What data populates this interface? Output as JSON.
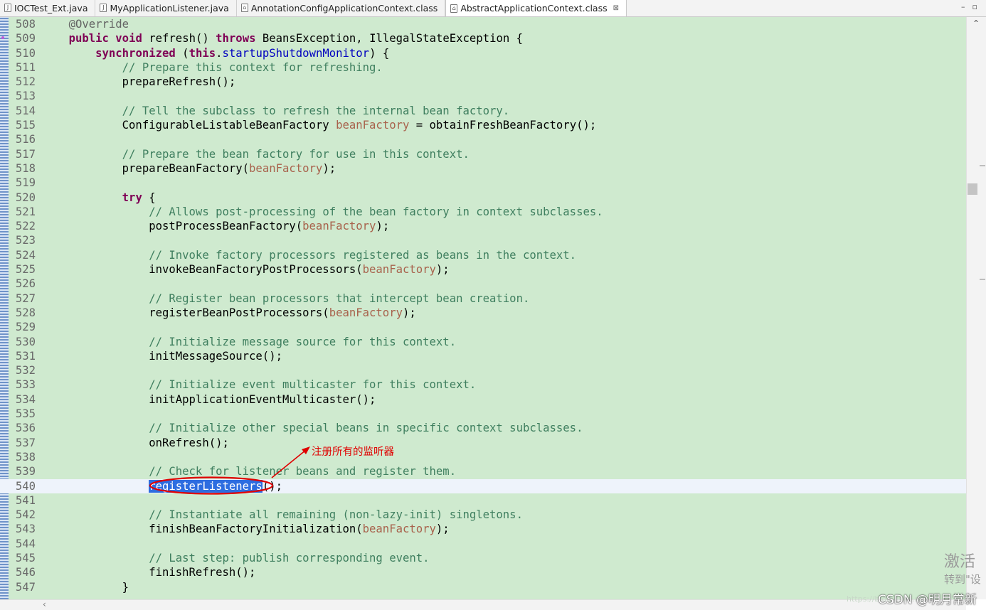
{
  "tabs": [
    {
      "label": "IOCTest_Ext.java",
      "icon": "java-file-icon",
      "active": false
    },
    {
      "label": "MyApplicationListener.java",
      "icon": "java-file-icon",
      "active": false
    },
    {
      "label": "AnnotationConfigApplicationContext.class",
      "icon": "class-file-icon",
      "active": false
    },
    {
      "label": "AbstractApplicationContext.class",
      "icon": "class-file-icon",
      "active": true,
      "close": "⊠"
    }
  ],
  "window_controls": {
    "minimize": "–",
    "maximize": "▫"
  },
  "editor": {
    "current_line": "540",
    "lines": [
      {
        "num": "508",
        "t": [
          {
            "c": "    "
          },
          {
            "c": "@Override",
            "k": "an"
          }
        ]
      },
      {
        "num": "509",
        "t": [
          {
            "c": "    "
          },
          {
            "c": "public",
            "k": "kw"
          },
          {
            "c": " "
          },
          {
            "c": "void",
            "k": "kw"
          },
          {
            "c": " refresh() "
          },
          {
            "c": "throws",
            "k": "kw"
          },
          {
            "c": " BeansException, IllegalStateException {"
          }
        ]
      },
      {
        "num": "510",
        "t": [
          {
            "c": "        "
          },
          {
            "c": "synchronized",
            "k": "kw"
          },
          {
            "c": " ("
          },
          {
            "c": "this",
            "k": "kw"
          },
          {
            "c": "."
          },
          {
            "c": "startupShutdownMonitor",
            "k": "fld"
          },
          {
            "c": ") {"
          }
        ]
      },
      {
        "num": "511",
        "t": [
          {
            "c": "            "
          },
          {
            "c": "// Prepare this context for refreshing.",
            "k": "cm"
          }
        ]
      },
      {
        "num": "512",
        "t": [
          {
            "c": "            prepareRefresh();"
          }
        ]
      },
      {
        "num": "513",
        "t": []
      },
      {
        "num": "514",
        "t": [
          {
            "c": "            "
          },
          {
            "c": "// Tell the subclass to refresh the internal bean factory.",
            "k": "cm"
          }
        ]
      },
      {
        "num": "515",
        "t": [
          {
            "c": "            ConfigurableListableBeanFactory "
          },
          {
            "c": "beanFactory",
            "k": "var"
          },
          {
            "c": " = obtainFreshBeanFactory();"
          }
        ]
      },
      {
        "num": "516",
        "t": []
      },
      {
        "num": "517",
        "t": [
          {
            "c": "            "
          },
          {
            "c": "// Prepare the bean factory for use in this context.",
            "k": "cm"
          }
        ]
      },
      {
        "num": "518",
        "t": [
          {
            "c": "            prepareBeanFactory("
          },
          {
            "c": "beanFactory",
            "k": "var"
          },
          {
            "c": ");"
          }
        ]
      },
      {
        "num": "519",
        "t": []
      },
      {
        "num": "520",
        "t": [
          {
            "c": "            "
          },
          {
            "c": "try",
            "k": "kw"
          },
          {
            "c": " {"
          }
        ]
      },
      {
        "num": "521",
        "t": [
          {
            "c": "                "
          },
          {
            "c": "// Allows post-processing of the bean factory in context subclasses.",
            "k": "cm"
          }
        ]
      },
      {
        "num": "522",
        "t": [
          {
            "c": "                postProcessBeanFactory("
          },
          {
            "c": "beanFactory",
            "k": "var"
          },
          {
            "c": ");"
          }
        ]
      },
      {
        "num": "523",
        "t": []
      },
      {
        "num": "524",
        "t": [
          {
            "c": "                "
          },
          {
            "c": "// Invoke factory processors registered as beans in the context.",
            "k": "cm"
          }
        ]
      },
      {
        "num": "525",
        "t": [
          {
            "c": "                invokeBeanFactoryPostProcessors("
          },
          {
            "c": "beanFactory",
            "k": "var"
          },
          {
            "c": ");"
          }
        ]
      },
      {
        "num": "526",
        "t": []
      },
      {
        "num": "527",
        "t": [
          {
            "c": "                "
          },
          {
            "c": "// Register bean processors that intercept bean creation.",
            "k": "cm"
          }
        ]
      },
      {
        "num": "528",
        "t": [
          {
            "c": "                registerBeanPostProcessors("
          },
          {
            "c": "beanFactory",
            "k": "var"
          },
          {
            "c": ");"
          }
        ]
      },
      {
        "num": "529",
        "t": []
      },
      {
        "num": "530",
        "t": [
          {
            "c": "                "
          },
          {
            "c": "// Initialize message source for this context.",
            "k": "cm"
          }
        ]
      },
      {
        "num": "531",
        "t": [
          {
            "c": "                initMessageSource();"
          }
        ]
      },
      {
        "num": "532",
        "t": []
      },
      {
        "num": "533",
        "t": [
          {
            "c": "                "
          },
          {
            "c": "// Initialize event multicaster for this context.",
            "k": "cm"
          }
        ]
      },
      {
        "num": "534",
        "t": [
          {
            "c": "                initApplicationEventMulticaster();"
          }
        ]
      },
      {
        "num": "535",
        "t": []
      },
      {
        "num": "536",
        "t": [
          {
            "c": "                "
          },
          {
            "c": "// Initialize other special beans in specific context subclasses.",
            "k": "cm"
          }
        ]
      },
      {
        "num": "537",
        "t": [
          {
            "c": "                onRefresh();"
          }
        ]
      },
      {
        "num": "538",
        "t": []
      },
      {
        "num": "539",
        "t": [
          {
            "c": "                "
          },
          {
            "c": "// Check for listener beans and register them.",
            "k": "cm"
          }
        ]
      },
      {
        "num": "540",
        "t": [
          {
            "c": "                "
          },
          {
            "c": "registerListeners",
            "k": "sel"
          },
          {
            "c": "();"
          }
        ]
      },
      {
        "num": "541",
        "t": []
      },
      {
        "num": "542",
        "t": [
          {
            "c": "                "
          },
          {
            "c": "// Instantiate all remaining (non-lazy-init) singletons.",
            "k": "cm"
          }
        ]
      },
      {
        "num": "543",
        "t": [
          {
            "c": "                finishBeanFactoryInitialization("
          },
          {
            "c": "beanFactory",
            "k": "var"
          },
          {
            "c": ");"
          }
        ]
      },
      {
        "num": "544",
        "t": []
      },
      {
        "num": "545",
        "t": [
          {
            "c": "                "
          },
          {
            "c": "// Last step: publish corresponding event.",
            "k": "cm"
          }
        ]
      },
      {
        "num": "546",
        "t": [
          {
            "c": "                finishRefresh();"
          }
        ]
      },
      {
        "num": "547",
        "t": [
          {
            "c": "            }"
          }
        ]
      }
    ]
  },
  "annotation": {
    "text": "注册所有的监听器",
    "color": "#e00000"
  },
  "scrollbar": {
    "up_arrow": "⌃",
    "left_arrow": "‹",
    "position": 0.27
  },
  "watermarks": {
    "activate": "激活",
    "activate_sub": "转到\"设",
    "url": "https://blog.csdn.net",
    "csdn": "CSDN @明月常新"
  },
  "colors": {
    "editor_bg": "#cfeacf",
    "keyword": "#7f0055",
    "comment": "#3f7f5f",
    "selection": "#2d6de0",
    "current_line": "#eef3fb"
  }
}
